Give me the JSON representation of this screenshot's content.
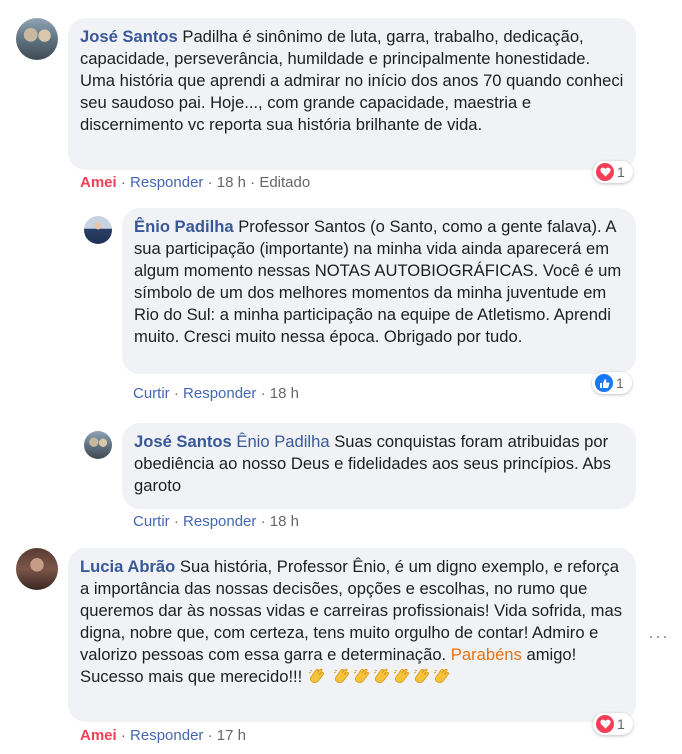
{
  "comments": [
    {
      "author": "José Santos",
      "mention": "",
      "text": "Padilha é sinônimo de luta, garra, trabalho, dedicação, capacidade, perseverância, humildade e principalmente honestidade. Uma história que aprendi a admirar no início dos anos 70 quando conheci seu saudoso pai. Hoje..., com grande capacidade, maestria e discernimento vc reporta sua história brilhante de vida.",
      "reaction_action": "Amei",
      "reply": "Responder",
      "time": "18 h",
      "edited": "Editado",
      "reaction_count": "1",
      "reaction_type": "heart-icon"
    },
    {
      "author": "Ênio Padilha",
      "mention": "",
      "text": "Professor Santos (o Santo, como a gente falava). A sua participação (importante) na minha vida ainda aparecerá em algum momento nessas NOTAS AUTOBIOGRÁFICAS. Você é um símbolo de um dos melhores momentos da minha juventude em Rio do Sul: a minha participação na equipe de Atletismo. Aprendi muito. Cresci muito nessa época. Obrigado por tudo.",
      "reaction_action": "Curtir",
      "reply": "Responder",
      "time": "18 h",
      "reaction_count": "1",
      "reaction_type": "like-icon"
    },
    {
      "author": "José Santos",
      "mention": "Ênio Padilha",
      "text": "Suas conquistas foram atribuidas por obediência ao nosso Deus e fidelidades aos seus princípios. Abs garoto",
      "reaction_action": "Curtir",
      "reply": "Responder",
      "time": "18 h"
    },
    {
      "author": "Lucia Abrão",
      "mention": "",
      "text_before": "Sua história, Professor Ênio, é um digno exemplo, e reforça a importância das nossas decisões, opções e escolhas, no rumo que queremos dar às nossas vidas e carreiras profissionais! Vida sofrida, mas digna, nobre que, com certeza, tens muito orgulho de contar! Admiro e valorizo pessoas com essa garra e determinação.",
      "highlight": "Parabéns",
      "text_after": "amigo! Sucesso mais que merecido!!!",
      "reaction_action": "Amei",
      "reply": "Responder",
      "time": "17 h",
      "reaction_count": "1",
      "reaction_type": "heart-icon",
      "clap_count": 7
    }
  ],
  "separator": "·",
  "more_options": "···"
}
